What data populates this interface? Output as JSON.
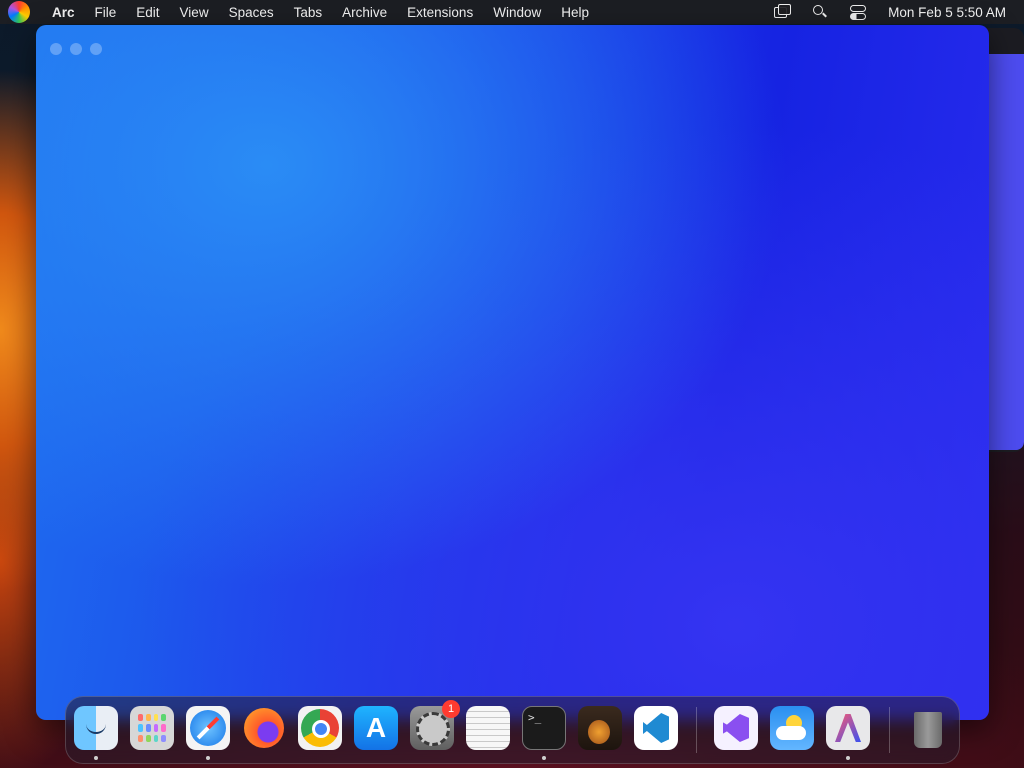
{
  "menubar": {
    "app_name": "Arc",
    "menus": [
      "File",
      "Edit",
      "View",
      "Spaces",
      "Tabs",
      "Archive",
      "Extensions",
      "Window",
      "Help"
    ],
    "clock": "Mon Feb 5  5:50 AM"
  },
  "dock": {
    "settings_badge": "1",
    "terminal_prompt": ">_",
    "appstore_glyph": "A",
    "apps": [
      {
        "name": "Finder",
        "icon": "finder-icon",
        "running": true
      },
      {
        "name": "Launchpad",
        "icon": "launchpad-icon",
        "running": false
      },
      {
        "name": "Safari",
        "icon": "safari-icon",
        "running": true
      },
      {
        "name": "Firefox",
        "icon": "firefox-icon",
        "running": false
      },
      {
        "name": "Google Chrome",
        "icon": "chrome-icon",
        "running": false
      },
      {
        "name": "App Store",
        "icon": "app-store-icon",
        "running": false
      },
      {
        "name": "System Settings",
        "icon": "system-settings-icon",
        "running": false
      },
      {
        "name": "TextEdit",
        "icon": "textedit-icon",
        "running": false
      },
      {
        "name": "Terminal",
        "icon": "terminal-icon",
        "running": true
      },
      {
        "name": "GarageBand",
        "icon": "garageband-icon",
        "running": false
      },
      {
        "name": "Visual Studio Code",
        "icon": "vscode-icon",
        "running": false
      },
      {
        "name": "Visual Studio",
        "icon": "visual-studio-icon",
        "running": false
      },
      {
        "name": "Weather",
        "icon": "weather-icon",
        "running": false
      },
      {
        "name": "Arc",
        "icon": "arc-icon",
        "running": true
      },
      {
        "name": "Trash",
        "icon": "trash-icon",
        "running": false
      }
    ]
  }
}
